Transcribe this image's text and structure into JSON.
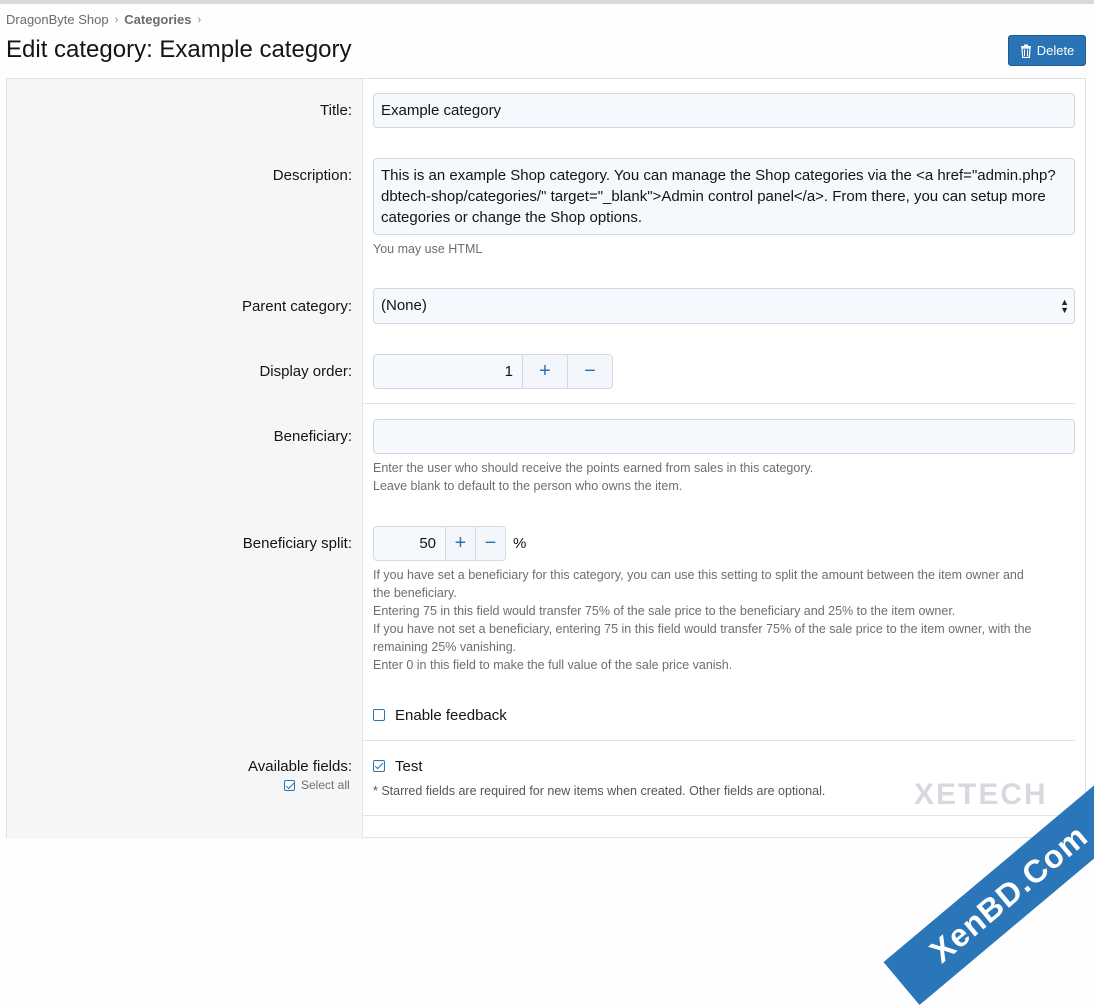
{
  "breadcrumb": {
    "items": [
      "DragonByte Shop",
      "Categories"
    ]
  },
  "page": {
    "title": "Edit category: Example category"
  },
  "actions": {
    "delete_label": "Delete"
  },
  "form": {
    "title": {
      "label": "Title:",
      "value": "Example category"
    },
    "description": {
      "label": "Description:",
      "value": "This is an example Shop category. You can manage the Shop categories via the <a href=\"admin.php?dbtech-shop/categories/\" target=\"_blank\">Admin control panel</a>. From there, you can setup more categories or change the Shop options.",
      "hint": "You may use HTML"
    },
    "parent_category": {
      "label": "Parent category:",
      "value": "(None)"
    },
    "display_order": {
      "label": "Display order:",
      "value": "1",
      "plus": "+",
      "minus": "−"
    },
    "beneficiary": {
      "label": "Beneficiary:",
      "value": "",
      "hint_line1": "Enter the user who should receive the points earned from sales in this category.",
      "hint_line2": "Leave blank to default to the person who owns the item."
    },
    "beneficiary_split": {
      "label": "Beneficiary split:",
      "value": "50",
      "unit": "%",
      "plus": "+",
      "minus": "−",
      "hint_line1": "If you have set a beneficiary for this category, you can use this setting to split the amount between the item owner and",
      "hint_line2": "the beneficiary.",
      "hint_line3": "Entering 75 in this field would transfer 75% of the sale price to the beneficiary and 25% to the item owner.",
      "hint_line4": "If you have not set a beneficiary, entering 75 in this field would transfer 75% of the sale price to the item owner, with the",
      "hint_line5": "remaining 25% vanishing.",
      "hint_line6": "Enter 0 in this field to make the full value of the sale price vanish."
    },
    "enable_feedback": {
      "label": "Enable feedback",
      "checked": false
    },
    "available_fields": {
      "label": "Available fields:",
      "select_all_label": "Select all",
      "select_all_checked": true,
      "items": [
        {
          "label": "Test",
          "checked": true
        }
      ],
      "hint": "* Starred fields are required for new items when created. Other fields are optional."
    }
  },
  "watermark": {
    "text": "XenBD.Com",
    "sub": "XETECH"
  },
  "colors": {
    "accent": "#2a73b4",
    "label_bg": "#f5f6f8",
    "input_bg": "#f5f8fc"
  }
}
